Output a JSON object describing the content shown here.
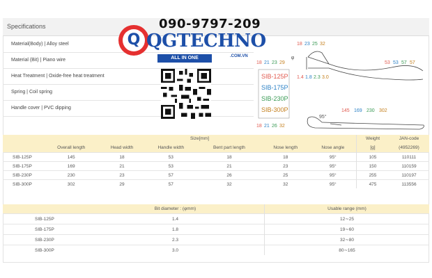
{
  "specifications": {
    "title": "Specifications",
    "rows": [
      "Material(Body) | Alloy steel",
      "Material (Bit) | Piano wire",
      "Heat Treatment | Oxide-free heat treatment",
      "Spring | Coil spring",
      "Handle cover | PVC dipping"
    ]
  },
  "watermark": {
    "phone": "090-9797-209",
    "brand_q": "Q",
    "brand": "QGTECHNO",
    "tagline": "ALL IN ONE",
    "domain": ".COM.VN"
  },
  "diagram": {
    "models": [
      "SIB-125P",
      "SIB-175P",
      "SIB-230P",
      "SIB-300P"
    ],
    "model_colors": [
      "#e05a4f",
      "#2d82c6",
      "#3a9a55",
      "#c47f1c"
    ],
    "bent_part_lengths": [
      "18",
      "21",
      "26",
      "32"
    ],
    "nose_lengths": [
      "18",
      "23",
      "25",
      "32"
    ],
    "handle_widths": [
      "53",
      "53",
      "57",
      "57"
    ],
    "bit_diameters": [
      "1.4",
      "1.8",
      "2.3",
      "3.0"
    ],
    "overall_lengths": [
      "145",
      "169",
      "230",
      "302"
    ],
    "head_widths": [
      "18",
      "21",
      "23",
      "29"
    ],
    "phi_symbol": "φ",
    "angle": "95°"
  },
  "table1": {
    "size_header": "Size[mm]",
    "headers": [
      "Overall length",
      "Head width",
      "Handle width",
      "Bent part length",
      "Nose length",
      "Nose angle"
    ],
    "weight_header": "Weight",
    "weight_unit": "[g]",
    "jan_header": "JAN-code",
    "jan_prefix": "(4952269)",
    "rows": [
      {
        "model": "SIB-125P",
        "overall": "145",
        "head": "18",
        "handle": "53",
        "bent": "18",
        "nose": "18",
        "angle": "95°",
        "weight": "105",
        "jan": "110111"
      },
      {
        "model": "SIB-175P",
        "overall": "169",
        "head": "21",
        "handle": "53",
        "bent": "21",
        "nose": "23",
        "angle": "95°",
        "weight": "150",
        "jan": "110159"
      },
      {
        "model": "SIB-230P",
        "overall": "230",
        "head": "23",
        "handle": "57",
        "bent": "26",
        "nose": "25",
        "angle": "95°",
        "weight": "255",
        "jan": "110197"
      },
      {
        "model": "SIB-300P",
        "overall": "302",
        "head": "29",
        "handle": "57",
        "bent": "32",
        "nose": "32",
        "angle": "95°",
        "weight": "475",
        "jan": "113556"
      }
    ]
  },
  "table2": {
    "headers": [
      "Bit diameter : (φmm)",
      "Usable range (mm)"
    ],
    "rows": [
      {
        "model": "SIB-125P",
        "bit": "1.4",
        "range": "12∼25"
      },
      {
        "model": "SIB-175P",
        "bit": "1.8",
        "range": "19∼60"
      },
      {
        "model": "SIB-230P",
        "bit": "2.3",
        "range": "32∼80"
      },
      {
        "model": "SIB-300P",
        "bit": "3.0",
        "range": "80∼165"
      }
    ]
  }
}
